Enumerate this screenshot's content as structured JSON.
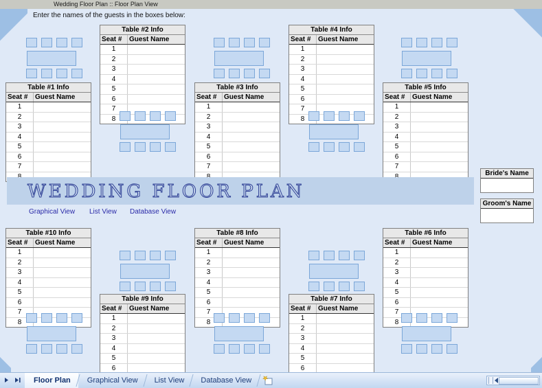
{
  "window": {
    "title": "Wedding Floor Plan :: Floor Plan View"
  },
  "instruction": "Enter the names of the guests in the boxes below:",
  "banner": {
    "title": "WEDDING FLOOR PLAN",
    "links": [
      {
        "label": "Graphical View"
      },
      {
        "label": "List View"
      },
      {
        "label": "Database View"
      }
    ]
  },
  "columns": {
    "seat": "Seat #",
    "guest": "Guest Name"
  },
  "seat_numbers": [
    "1",
    "2",
    "3",
    "4",
    "5",
    "6",
    "7",
    "8"
  ],
  "tables": [
    {
      "id": "table-1",
      "title": "Table #1 Info"
    },
    {
      "id": "table-2",
      "title": "Table #2 Info"
    },
    {
      "id": "table-3",
      "title": "Table #3 Info"
    },
    {
      "id": "table-4",
      "title": "Table #4 Info"
    },
    {
      "id": "table-5",
      "title": "Table #5 Info"
    },
    {
      "id": "table-6",
      "title": "Table #6 Info"
    },
    {
      "id": "table-7",
      "title": "Table #7 Info"
    },
    {
      "id": "table-8",
      "title": "Table #8 Info"
    },
    {
      "id": "table-9",
      "title": "Table #9 Info"
    },
    {
      "id": "table-10",
      "title": "Table #10 Info"
    }
  ],
  "name_boxes": {
    "bride": {
      "title": "Bride's Name",
      "value": ""
    },
    "groom": {
      "title": "Groom's Name",
      "value": ""
    }
  },
  "sheet_tabs": [
    {
      "label": "Floor Plan",
      "active": true
    },
    {
      "label": "Graphical View",
      "active": false
    },
    {
      "label": "List View",
      "active": false
    },
    {
      "label": "Database View",
      "active": false
    }
  ],
  "colors": {
    "page_background": "#dfe9f7",
    "chair_fill": "#c4d9f2",
    "chair_border": "#7aa6d8",
    "banner_fill": "#bed2ea",
    "link": "#2a2aa8",
    "title_outline": "#2d3f94",
    "header_strip": "#c8c9c2"
  }
}
